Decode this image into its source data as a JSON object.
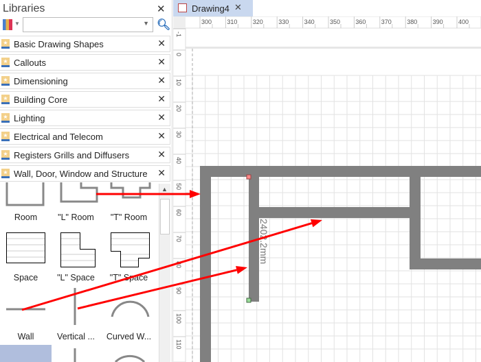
{
  "libraries": {
    "title": "Libraries",
    "search": {
      "value": "",
      "placeholder": ""
    },
    "items": [
      {
        "label": "Basic Drawing Shapes"
      },
      {
        "label": "Callouts"
      },
      {
        "label": "Dimensioning"
      },
      {
        "label": "Building Core"
      },
      {
        "label": "Lighting"
      },
      {
        "label": "Electrical and Telecom"
      },
      {
        "label": "Registers Grills and Diffusers"
      },
      {
        "label": "Wall, Door, Window and Structure"
      }
    ],
    "shapes": [
      {
        "label": "Room"
      },
      {
        "label": "\"L\" Room"
      },
      {
        "label": "\"T\" Room"
      },
      {
        "label": "Space"
      },
      {
        "label": "\"L\" Space"
      },
      {
        "label": "\"T\" Space"
      },
      {
        "label": "Wall"
      },
      {
        "label": "Vertical ..."
      },
      {
        "label": "Curved W..."
      }
    ]
  },
  "tab": {
    "label": "Drawing4"
  },
  "ruler": {
    "h": [
      "300",
      "310",
      "320",
      "330",
      "340",
      "350",
      "360",
      "370",
      "380",
      "390",
      "400"
    ],
    "v": [
      "-1",
      "0",
      "10",
      "20",
      "30",
      "40",
      "50",
      "60",
      "70",
      "80",
      "90",
      "100",
      "110"
    ]
  },
  "dimension": "2402.2mm",
  "colors": {
    "wall": "#808080",
    "arrow": "#ff0000",
    "tab": "#c9d8ef",
    "selected": "#b0bedd"
  }
}
